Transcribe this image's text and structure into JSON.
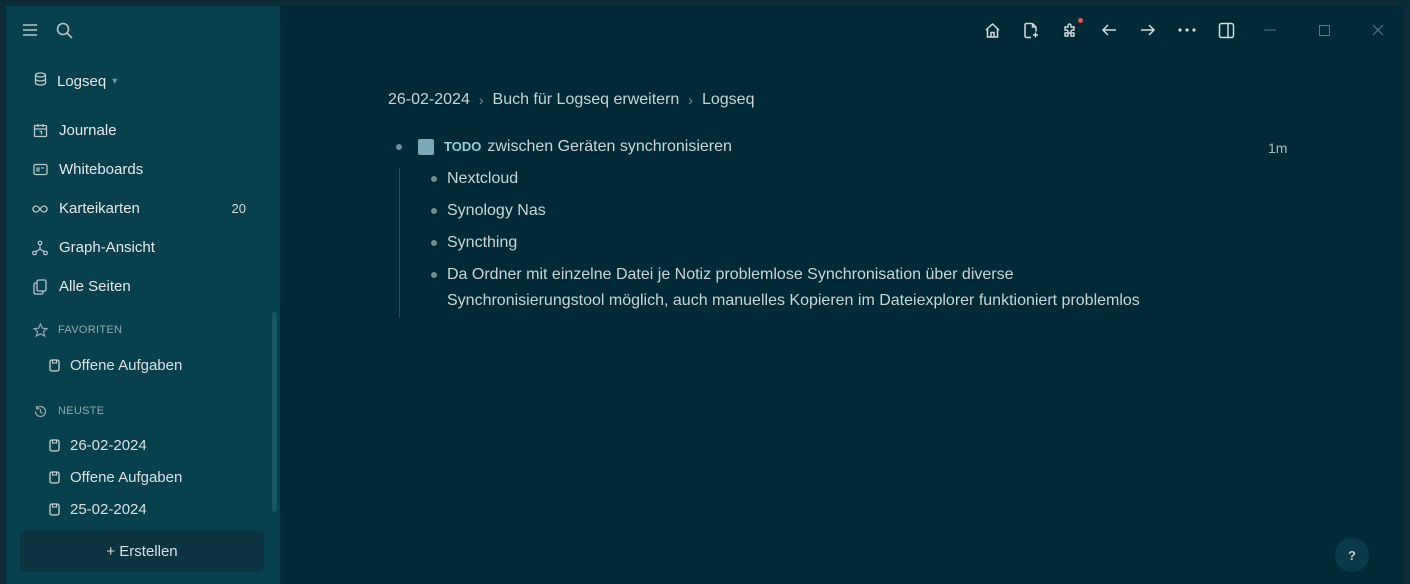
{
  "sidebar": {
    "graph_name": "Logseq",
    "nav": [
      {
        "label": "Journale",
        "icon": "calendar-icon"
      },
      {
        "label": "Whiteboards",
        "icon": "whiteboard-icon"
      },
      {
        "label": "Karteikarten",
        "icon": "infinity-icon",
        "count": "20"
      },
      {
        "label": "Graph-Ansicht",
        "icon": "graph-icon"
      },
      {
        "label": "Alle Seiten",
        "icon": "pages-icon"
      }
    ],
    "favorites_title": "FAVORITEN",
    "favorites": [
      "Offene Aufgaben"
    ],
    "recent_title": "NEUSTE",
    "recent": [
      "26-02-2024",
      "Offene Aufgaben",
      "25-02-2024"
    ],
    "create_label": "+ Erstellen"
  },
  "toolbar": {
    "icons": [
      "home-icon",
      "new-page-icon",
      "plugins-icon",
      "back-arrow-icon",
      "forward-arrow-icon",
      "more-icon",
      "right-sidebar-icon"
    ],
    "window_controls": [
      "minimize-icon",
      "maximize-icon",
      "close-icon"
    ]
  },
  "breadcrumb": [
    "26-02-2024",
    "Buch für Logseq erweitern",
    "Logseq"
  ],
  "main_block": {
    "marker": "TODO",
    "text": "zwischen Geräten synchronisieren",
    "time": "1m"
  },
  "children": [
    "Nextcloud",
    "Synology Nas",
    "Syncthing"
  ],
  "long_child": {
    "line1": "Da Ordner mit einzelne Datei je Notiz problemlose Synchronisation über diverse",
    "line2": "Synchronisierungstool möglich, auch manuelles Kopieren im Dateiexplorer funktioniert problemlos"
  },
  "help_label": "?",
  "colors": {
    "background": "#002b36",
    "sidebar": "#08404d",
    "todo_marker": "#8ecfe0",
    "notification_dot": "#e0545a"
  }
}
